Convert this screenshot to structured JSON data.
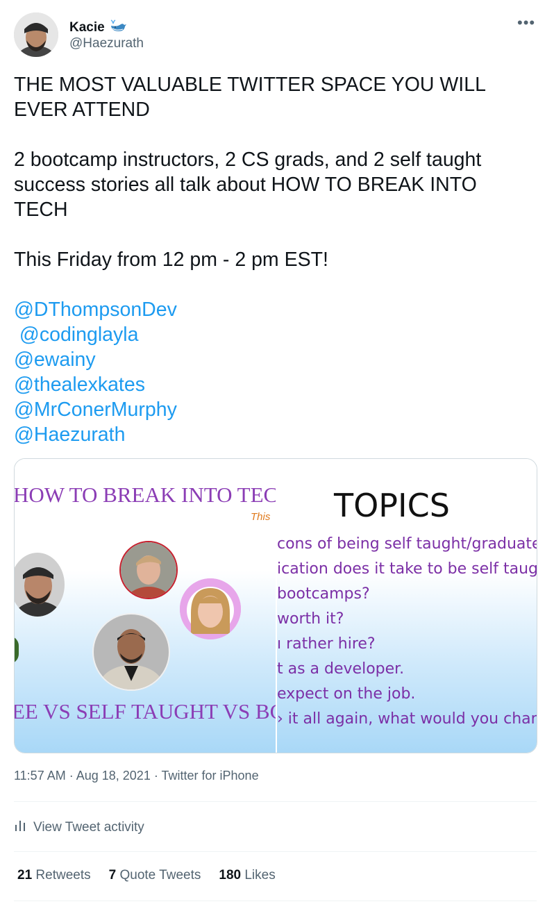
{
  "author": {
    "name": "Kacie",
    "handle": "@Haezurath",
    "badge_icon": "whale-emoji"
  },
  "tweet": {
    "headline_1": "THE MOST VALUABLE TWITTER SPACE YOU WILL",
    "headline_2": "EVER ATTEND",
    "body_1": "2 bootcamp instructors, 2 CS grads, and 2 self taught",
    "body_2": "success stories all talk about HOW TO BREAK INTO",
    "body_3": "TECH",
    "schedule": "This Friday from 12 pm - 2 pm EST!",
    "mentions": [
      "@DThompsonDev",
      " @codinglayla",
      "@ewainy",
      "@thealexkates",
      "@MrConerMurphy",
      "@Haezurath"
    ]
  },
  "media": {
    "left": {
      "title": "HOW TO BREAK INTO TEC",
      "subtitle_fragment": "This",
      "bottom_text": "EE VS SELF TAUGHT VS BC"
    },
    "right": {
      "title": "TOPICS",
      "lines": [
        "cons of being self taught/graduated/b",
        "ication does it take to be self taught?",
        "bootcamps?",
        "worth it?",
        "ı rather hire?",
        "t as a developer.",
        "expect on the job.",
        "› it all again, what would you change?"
      ]
    }
  },
  "meta": {
    "time": "11:57 AM",
    "sep1": " · ",
    "date": "Aug 18, 2021",
    "sep2": " · ",
    "source": "Twitter for iPhone"
  },
  "activity": {
    "label": "View Tweet activity"
  },
  "stats": {
    "retweets_count": "21",
    "retweets_label": "Retweets",
    "quotes_count": "7",
    "quotes_label": "Quote Tweets",
    "likes_count": "180",
    "likes_label": "Likes"
  },
  "colors": {
    "link": "#1d9bf0",
    "muted": "#536471",
    "purple": "#8b3db5"
  }
}
